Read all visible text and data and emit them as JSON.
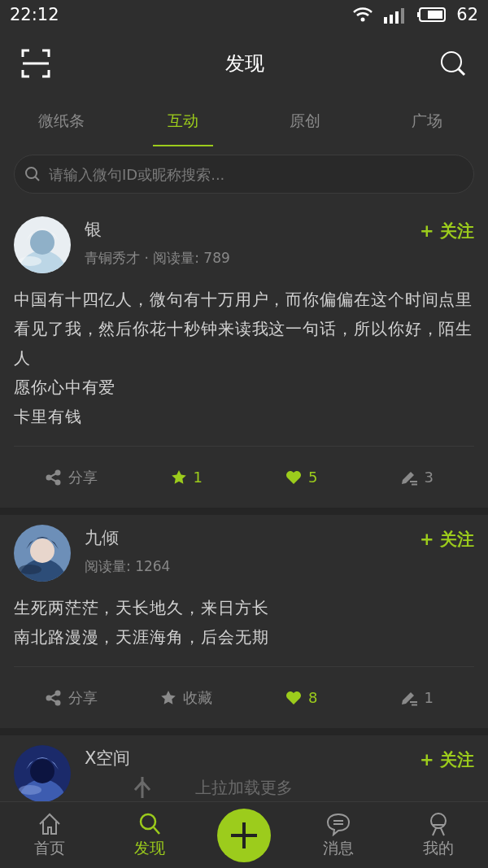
{
  "status_bar": {
    "time": "22:12",
    "battery": "62"
  },
  "header": {
    "title": "发现"
  },
  "tabs": [
    {
      "label": "微纸条",
      "selected": false
    },
    {
      "label": "互动",
      "selected": true
    },
    {
      "label": "原创",
      "selected": false
    },
    {
      "label": "广场",
      "selected": false
    }
  ],
  "search": {
    "placeholder": "请输入微句ID或昵称搜索..."
  },
  "posts": [
    {
      "avatar": {
        "kind": "picture"
      },
      "name": "银",
      "subtitle": "青铜秀才 · 阅读量: 789",
      "follow": "+ 关注",
      "lines": [
        "中国有十四亿人，微句有十万用户，而你偏偏在这个时间点里看见了我，然后你花十秒钟来读我这一句话，所以你好，陌生人",
        "愿你心中有爱",
        "卡里有钱"
      ],
      "share": "分享",
      "collect": {
        "label": "1",
        "collected": true
      },
      "like": {
        "label": "5",
        "liked": true
      },
      "comment": "3"
    },
    {
      "avatar": {
        "kind": "picture"
      },
      "name": "九倾",
      "subtitle": "阅读量: 1264",
      "follow": "+ 关注",
      "lines": [
        "生死两茫茫，天长地久，来日方长",
        "南北路漫漫，天涯海角，后会无期"
      ],
      "share": "分享",
      "collect": {
        "label": "收藏",
        "collected": false
      },
      "like": {
        "label": "8",
        "liked": true
      },
      "comment": "1"
    },
    {
      "avatar": {
        "kind": "picture"
      },
      "name": "X空间",
      "follow": "+ 关注"
    }
  ],
  "loading": "上拉加载更多",
  "nav": [
    {
      "label": "首页",
      "selected": false
    },
    {
      "label": "发现",
      "selected": true
    },
    {
      "kind": "add",
      "selected": false
    },
    {
      "label": "消息",
      "selected": false
    },
    {
      "label": "我的",
      "selected": false
    }
  ]
}
